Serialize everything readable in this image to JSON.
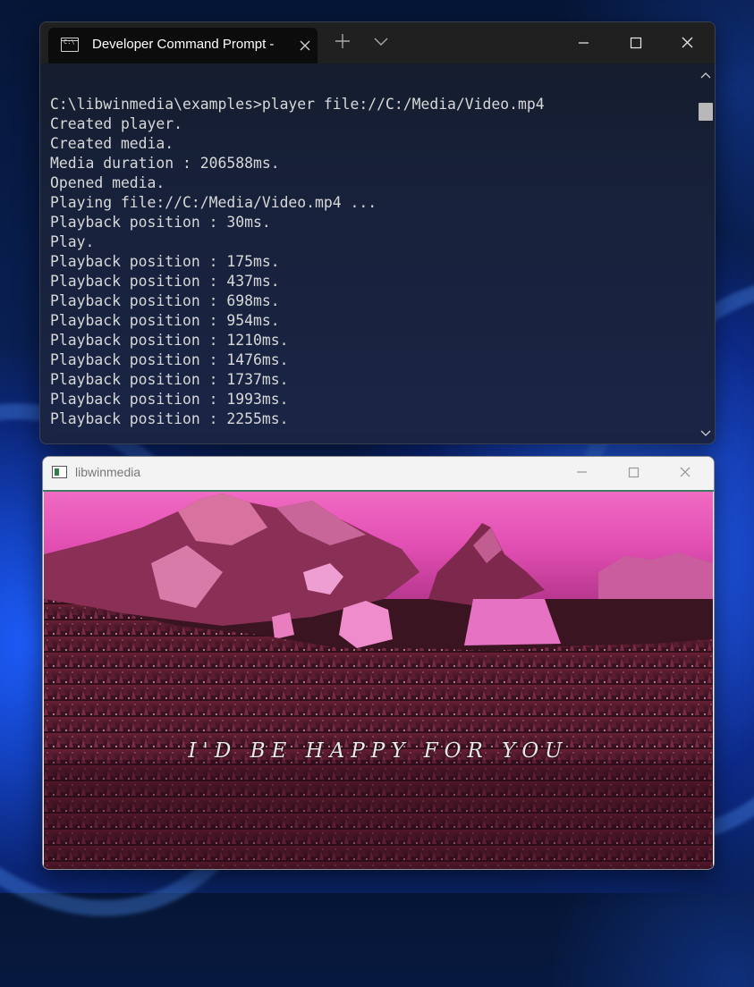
{
  "desktop": {
    "accent": "#1c4fd6"
  },
  "terminal": {
    "tab_title": "Developer Command Prompt -",
    "tab_icon_text": "C:\\",
    "colors": {
      "background": "#17213a",
      "text": "#d8d8d8",
      "titlebar": "#202020"
    },
    "lines": [
      "C:\\libwinmedia\\examples>player file://C:/Media/Video.mp4",
      "Created player.",
      "Created media.",
      "Media duration : 206588ms.",
      "Opened media.",
      "Playing file://C:/Media/Video.mp4 ...",
      "Playback position : 30ms.",
      "Play.",
      "Playback position : 175ms.",
      "Playback position : 437ms.",
      "Playback position : 698ms.",
      "Playback position : 954ms.",
      "Playback position : 1210ms.",
      "Playback position : 1476ms.",
      "Playback position : 1737ms.",
      "Playback position : 1993ms.",
      "Playback position : 2255ms."
    ]
  },
  "player": {
    "title": "libwinmedia",
    "caption": "I'D BE HAPPY FOR YOU",
    "colors": {
      "accent_line": "#3c7b64",
      "sky": "#e24fb3"
    }
  }
}
